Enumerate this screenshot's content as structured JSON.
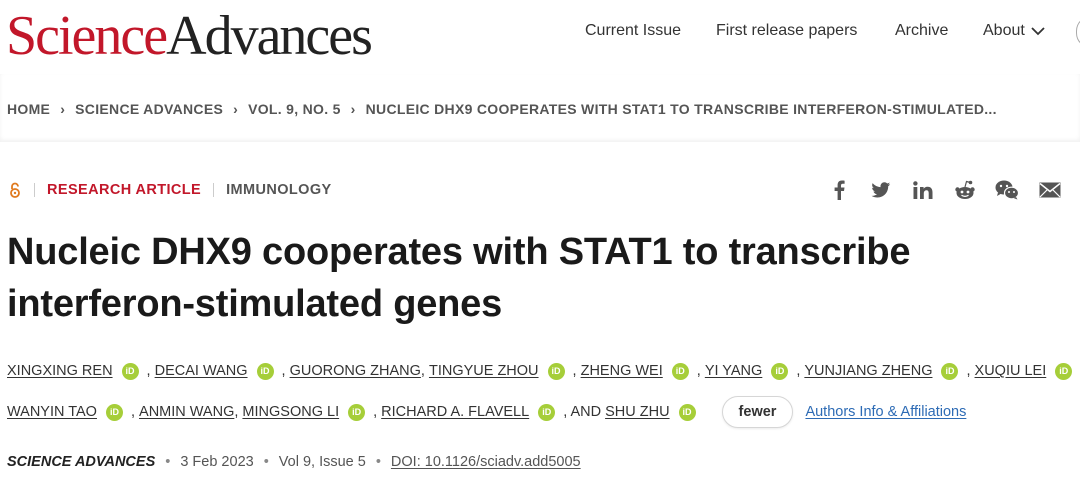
{
  "header": {
    "logo": {
      "science": "Science",
      "advances": "Advances"
    },
    "nav": {
      "current_issue": "Current Issue",
      "first_release": "First release papers",
      "archive": "Archive",
      "about": "About"
    }
  },
  "breadcrumb": {
    "home": "HOME",
    "journal": "SCIENCE ADVANCES",
    "issue": "VOL. 9, NO. 5",
    "article": "NUCLEIC DHX9 COOPERATES WITH STAT1 TO TRANSCRIBE INTERFERON-STIMULATED..."
  },
  "article": {
    "open_access_icon": "open-access-lock-icon",
    "type": "RESEARCH ARTICLE",
    "subject": "IMMUNOLOGY",
    "title": "Nucleic DHX9 cooperates with STAT1 to transcribe interferon-stimulated genes"
  },
  "share_icons": [
    "facebook-icon",
    "twitter-icon",
    "linkedin-icon",
    "reddit-icon",
    "wechat-icon",
    "email-icon"
  ],
  "authors": {
    "line1": [
      {
        "name": "XINGXING REN",
        "orcid": true,
        "sep": ", "
      },
      {
        "name": "DECAI WANG",
        "orcid": true,
        "sep": ", "
      },
      {
        "name": "GUORONG ZHANG",
        "orcid": false,
        "sep": ", "
      },
      {
        "name": "TINGYUE ZHOU",
        "orcid": true,
        "sep": ", "
      },
      {
        "name": "ZHENG WEI",
        "orcid": true,
        "sep": ", "
      },
      {
        "name": "YI YANG",
        "orcid": true,
        "sep": ", "
      },
      {
        "name": "YUNJIANG ZHENG",
        "orcid": true,
        "sep": ", "
      },
      {
        "name": "XUQIU LEI",
        "orcid": true,
        "sep": ", "
      }
    ],
    "line2": [
      {
        "name": "WANYIN TAO",
        "orcid": true,
        "sep": ", "
      },
      {
        "name": "ANMIN WANG",
        "orcid": false,
        "sep": ", "
      },
      {
        "name": "MINGSONG LI",
        "orcid": true,
        "sep": ", "
      },
      {
        "name": "RICHARD A. FLAVELL",
        "orcid": true,
        "sep": ", AND "
      },
      {
        "name": "SHU ZHU",
        "orcid": true,
        "sep": ""
      }
    ],
    "orcid_label": "iD",
    "fewer_button": "fewer",
    "affiliations_link": "Authors Info & Affiliations"
  },
  "meta": {
    "journal": "SCIENCE ADVANCES",
    "date": "3 Feb 2023",
    "volume": "Vol 9, Issue 5",
    "doi": "DOI: 10.1126/sciadv.add5005",
    "dot": "•"
  },
  "colors": {
    "brand_red": "#c2172a",
    "orcid_green": "#a6ce39",
    "link_blue": "#2d6bb5"
  }
}
